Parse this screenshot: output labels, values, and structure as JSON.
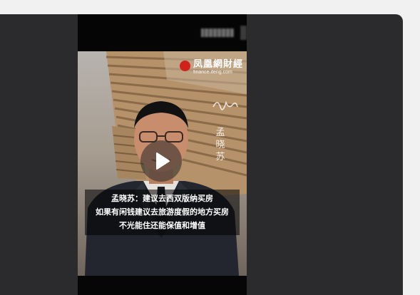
{
  "video": {
    "watermark": {
      "brand": "凤凰網財經",
      "domain": "finance.ifeng.com"
    },
    "overlay_name": "孟晓苏",
    "captions": [
      "孟晓苏：建议去西双版纳买房",
      "如果有闲钱建议去旅游度假的地方买房",
      "不光能住还能保值和增值"
    ],
    "play_icon": "play-icon",
    "brand_color": "#d0211c"
  }
}
